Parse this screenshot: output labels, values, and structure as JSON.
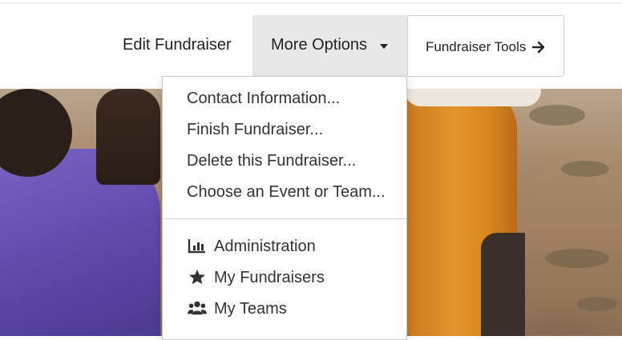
{
  "nav": {
    "edit_label": "Edit Fundraiser",
    "more_options_label": "More Options",
    "tools_label": "Fundraiser Tools",
    "tools_icon": "arrow-right-icon",
    "more_options_icon": "caret-down-icon"
  },
  "dropdown": {
    "items": [
      {
        "label": "Contact Information..."
      },
      {
        "label": "Finish Fundraiser..."
      },
      {
        "label": "Delete this Fundraiser..."
      },
      {
        "label": "Choose an Event or Team..."
      }
    ],
    "links": [
      {
        "label": "Administration",
        "icon": "bar-chart-icon"
      },
      {
        "label": "My Fundraisers",
        "icon": "star-icon"
      },
      {
        "label": "My Teams",
        "icon": "users-icon"
      }
    ]
  },
  "colors": {
    "active_menu_bg": "#e8e8e8",
    "text": "#222222",
    "robe_orange": "#e4952d",
    "shirt_purple": "#6a52b8"
  }
}
